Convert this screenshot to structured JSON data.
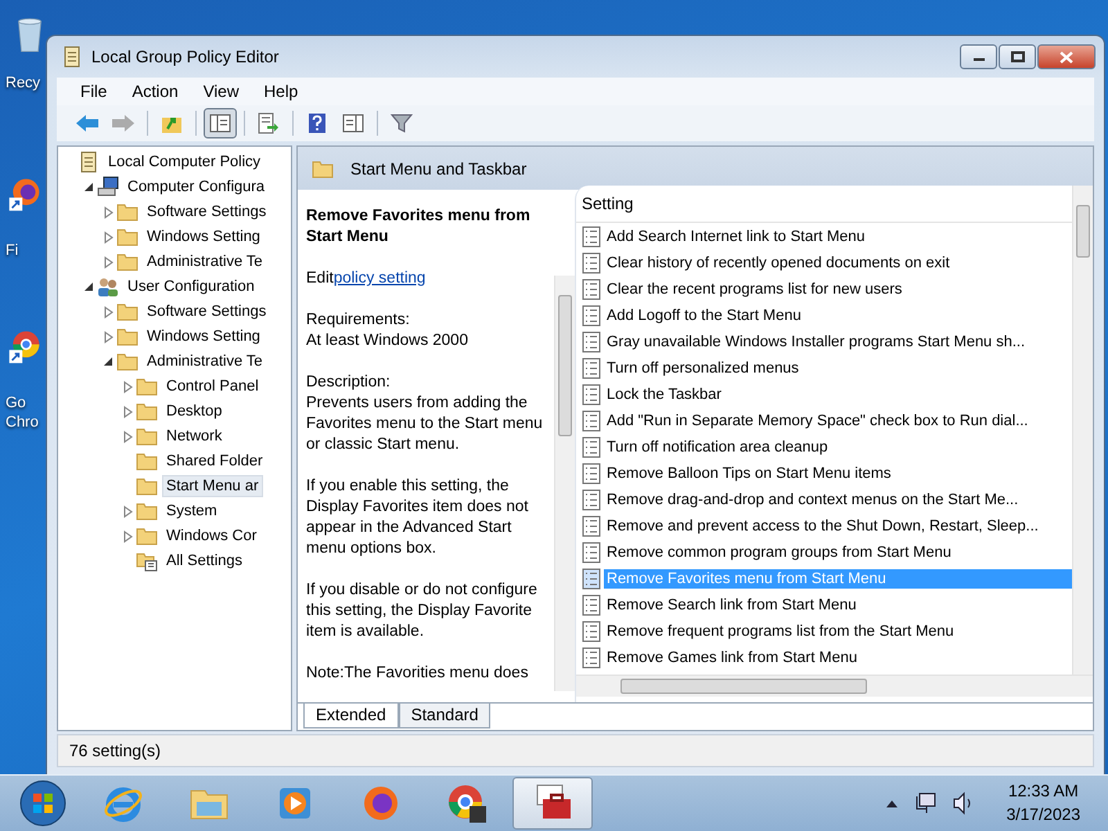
{
  "desktop_icons": [
    {
      "kind": "recycle-bin",
      "lines": [
        "Recy"
      ]
    },
    {
      "kind": "firefox",
      "lines": [
        "Fi"
      ]
    },
    {
      "kind": "chrome",
      "lines": [
        "Go",
        "Chro"
      ]
    }
  ],
  "window": {
    "title": "Local Group Policy Editor"
  },
  "menu": [
    "File",
    "Action",
    "View",
    "Help"
  ],
  "toolbar": [
    {
      "kind": "back",
      "disabled": false,
      "pressed": false
    },
    {
      "kind": "forward",
      "disabled": true,
      "pressed": false
    },
    {
      "kind": "up",
      "disabled": false,
      "pressed": false
    },
    {
      "kind": "tree",
      "disabled": false,
      "pressed": true
    },
    {
      "kind": "export",
      "disabled": false,
      "pressed": false
    },
    {
      "kind": "help",
      "disabled": false,
      "pressed": false
    },
    {
      "kind": "pane",
      "disabled": false,
      "pressed": false
    },
    {
      "kind": "filter",
      "disabled": false,
      "pressed": false
    }
  ],
  "tree": [
    {
      "label": "Local Computer Policy",
      "kind": "policy",
      "selected": false,
      "children": [
        {
          "label": "Computer Configura",
          "kind": "computer",
          "expanded": true,
          "selected": false,
          "children": [
            {
              "label": "Software Settings",
              "kind": "folder",
              "expanded": false,
              "selected": false
            },
            {
              "label": "Windows Setting",
              "kind": "folder",
              "expanded": false,
              "selected": false
            },
            {
              "label": "Administrative Te",
              "kind": "folder",
              "expanded": false,
              "selected": false
            }
          ]
        },
        {
          "label": "User Configuration",
          "kind": "users",
          "expanded": true,
          "selected": false,
          "children": [
            {
              "label": "Software Settings",
              "kind": "folder",
              "expanded": false,
              "selected": false
            },
            {
              "label": "Windows Setting",
              "kind": "folder",
              "expanded": false,
              "selected": false
            },
            {
              "label": "Administrative Te",
              "kind": "folder",
              "expanded": true,
              "selected": false,
              "children": [
                {
                  "label": "Control Panel",
                  "kind": "folder",
                  "expanded": false,
                  "selected": false
                },
                {
                  "label": "Desktop",
                  "kind": "folder",
                  "expanded": false,
                  "selected": false
                },
                {
                  "label": "Network",
                  "kind": "folder",
                  "expanded": false,
                  "selected": false
                },
                {
                  "label": "Shared Folder",
                  "kind": "folder",
                  "selected": false
                },
                {
                  "label": "Start Menu ar",
                  "kind": "folder",
                  "selected": true
                },
                {
                  "label": "System",
                  "kind": "folder",
                  "expanded": false,
                  "selected": false
                },
                {
                  "label": "Windows Cor",
                  "kind": "folder",
                  "expanded": false,
                  "selected": false
                },
                {
                  "label": "All Settings",
                  "kind": "all-settings",
                  "selected": false
                }
              ]
            }
          ]
        }
      ]
    }
  ],
  "pane_header": "Start Menu and Taskbar",
  "description": {
    "title": "Remove Favorites menu from Start Menu",
    "edit_prefix": "Edit",
    "edit_link": "policy setting",
    "paragraphs": [
      [
        "Requirements:",
        "At least Windows 2000"
      ],
      [
        "Description:",
        "Prevents users from adding the Favorites menu to the Start menu or classic Start menu."
      ],
      [
        "If you enable this setting, the Display Favorites item does not appear in the Advanced Start menu options box."
      ],
      [
        "If you disable or do not configure this setting, the Display Favorite item is available."
      ],
      [
        "Note:The Favorities menu does"
      ]
    ]
  },
  "settings": {
    "column": "Setting",
    "rows": [
      {
        "text": "Add Search Internet link to Start Menu",
        "selected": false
      },
      {
        "text": "Clear history of recently opened documents on exit",
        "selected": false
      },
      {
        "text": "Clear the recent programs list for new users",
        "selected": false
      },
      {
        "text": "Add Logoff to the Start Menu",
        "selected": false
      },
      {
        "text": "Gray unavailable Windows Installer programs Start Menu sh...",
        "selected": false
      },
      {
        "text": "Turn off personalized menus",
        "selected": false
      },
      {
        "text": "Lock the Taskbar",
        "selected": false
      },
      {
        "text": "Add \"Run in Separate Memory Space\" check box to Run dial...",
        "selected": false
      },
      {
        "text": "Turn off notification area cleanup",
        "selected": false
      },
      {
        "text": "Remove Balloon Tips on Start Menu items",
        "selected": false
      },
      {
        "text": "Remove drag-and-drop and context menus on the Start Me...",
        "selected": false
      },
      {
        "text": "Remove and prevent access to the Shut Down, Restart, Sleep...",
        "selected": false
      },
      {
        "text": "Remove common program groups from Start Menu",
        "selected": false
      },
      {
        "text": "Remove Favorites menu from Start Menu",
        "selected": true
      },
      {
        "text": "Remove Search link from Start Menu",
        "selected": false
      },
      {
        "text": "Remove frequent programs list from the Start Menu",
        "selected": false
      },
      {
        "text": "Remove Games link from Start Menu",
        "selected": false
      }
    ]
  },
  "tabs": [
    {
      "label": "Extended",
      "selected": true
    },
    {
      "label": "Standard",
      "selected": false
    }
  ],
  "status_bar": "76 setting(s)",
  "taskbar": {
    "apps": [
      {
        "kind": "ie",
        "active": false
      },
      {
        "kind": "explorer",
        "active": false
      },
      {
        "kind": "media",
        "active": false
      },
      {
        "kind": "firefox",
        "active": false
      },
      {
        "kind": "chrome",
        "active": false
      },
      {
        "kind": "toolbox",
        "active": true
      }
    ],
    "time": "12:33 AM",
    "date": "3/17/2023"
  }
}
